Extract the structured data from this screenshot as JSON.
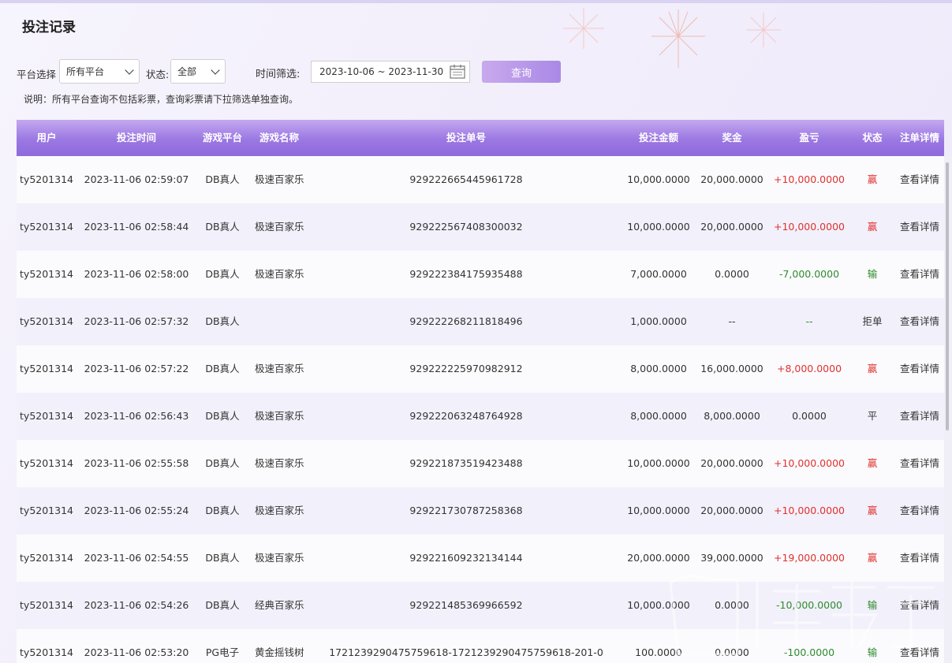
{
  "page": {
    "title": "投注记录"
  },
  "filters": {
    "platform_label": "平台选择",
    "platform_value": "所有平台",
    "status_label": "状态:",
    "status_value": "全部",
    "time_label": "时间筛选:",
    "date_range": "2023-10-06 ~ 2023-11-30",
    "query_button": "查询",
    "note": "说明：所有平台查询不包括彩票，查询彩票请下拉筛选单独查询。"
  },
  "table": {
    "headers": [
      "用户",
      "投注时间",
      "游戏平台",
      "游戏名称",
      "投注单号",
      "投注金额",
      "奖金",
      "盈亏",
      "状态",
      "注单详情"
    ],
    "rows": [
      [
        "ty5201314",
        "2023-11-06 02:59:07",
        "DB真人",
        "极速百家乐",
        "929222665445961728",
        "10,000.0000",
        "20,000.0000",
        "+10,000.0000",
        "赢",
        "查看详情"
      ],
      [
        "ty5201314",
        "2023-11-06 02:58:44",
        "DB真人",
        "极速百家乐",
        "929222567408300032",
        "10,000.0000",
        "20,000.0000",
        "+10,000.0000",
        "赢",
        "查看详情"
      ],
      [
        "ty5201314",
        "2023-11-06 02:58:00",
        "DB真人",
        "极速百家乐",
        "929222384175935488",
        "7,000.0000",
        "0.0000",
        "-7,000.0000",
        "输",
        "查看详情"
      ],
      [
        "ty5201314",
        "2023-11-06 02:57:32",
        "DB真人",
        "",
        "929222268211818496",
        "1,000.0000",
        "--",
        "--",
        "拒单",
        "查看详情"
      ],
      [
        "ty5201314",
        "2023-11-06 02:57:22",
        "DB真人",
        "极速百家乐",
        "929222225970982912",
        "8,000.0000",
        "16,000.0000",
        "+8,000.0000",
        "赢",
        "查看详情"
      ],
      [
        "ty5201314",
        "2023-11-06 02:56:43",
        "DB真人",
        "极速百家乐",
        "929222063248764928",
        "8,000.0000",
        "8,000.0000",
        "0.0000",
        "平",
        "查看详情"
      ],
      [
        "ty5201314",
        "2023-11-06 02:55:58",
        "DB真人",
        "极速百家乐",
        "929221873519423488",
        "10,000.0000",
        "20,000.0000",
        "+10,000.0000",
        "赢",
        "查看详情"
      ],
      [
        "ty5201314",
        "2023-11-06 02:55:24",
        "DB真人",
        "极速百家乐",
        "929221730787258368",
        "10,000.0000",
        "20,000.0000",
        "+10,000.0000",
        "赢",
        "查看详情"
      ],
      [
        "ty5201314",
        "2023-11-06 02:54:55",
        "DB真人",
        "极速百家乐",
        "929221609232134144",
        "20,000.0000",
        "39,000.0000",
        "+19,000.0000",
        "赢",
        "查看详情"
      ],
      [
        "ty5201314",
        "2023-11-06 02:54:26",
        "DB真人",
        "经典百家乐",
        "929221485369966592",
        "10,000.0000",
        "0.0000",
        "-10,000.0000",
        "输",
        "查看详情"
      ],
      [
        "ty5201314",
        "2023-11-06 02:53:20",
        "PG电子",
        "黄金摇钱树",
        "1721239290475759618-1721239290475759618-201-0",
        "100.0000",
        "0.0000",
        "-100.0000",
        "输",
        "查看详情"
      ]
    ]
  },
  "colors": {
    "win": "#e0312f",
    "lose": "#2e8b2e",
    "header_purple": "#9b78e2"
  },
  "icons": {
    "calendar": "calendar-icon",
    "dropdown": "chevron-down-icon"
  }
}
